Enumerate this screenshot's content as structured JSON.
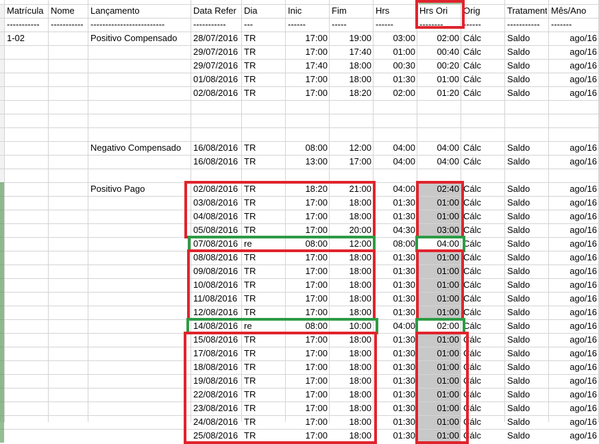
{
  "headers": [
    "Matrícula",
    "Nome",
    "Lançamento",
    "Data Refer",
    "Dia",
    "Inic",
    "Fim",
    "Hrs",
    "Hrs Ori",
    "Orig",
    "Tratament",
    "Mês/Ano"
  ],
  "dashes": [
    "-----------",
    "-----------",
    "-------------------------",
    "-----------",
    "---",
    "------",
    "-----",
    "------",
    "--------",
    "------",
    "-----------",
    "-------"
  ],
  "colors": {
    "red_box": "#e0242d",
    "green_box": "#2e9b45",
    "gray_fill": "#c8c8c8",
    "gridline": "#d4d4d4"
  },
  "groups": [
    {
      "matricula": "1-02",
      "lancamento": "Positivo Compensado",
      "rows": [
        [
          "28/07/2016",
          "TR",
          "17:00",
          "19:00",
          "03:00",
          "02:00",
          "Cálc",
          "Saldo",
          "ago/16"
        ],
        [
          "29/07/2016",
          "TR",
          "17:00",
          "17:40",
          "01:00",
          "00:40",
          "Cálc",
          "Saldo",
          "ago/16"
        ],
        [
          "29/07/2016",
          "TR",
          "17:40",
          "18:00",
          "00:30",
          "00:20",
          "Cálc",
          "Saldo",
          "ago/16"
        ],
        [
          "01/08/2016",
          "TR",
          "17:00",
          "18:00",
          "01:30",
          "01:00",
          "Cálc",
          "Saldo",
          "ago/16"
        ],
        [
          "02/08/2016",
          "TR",
          "17:00",
          "18:20",
          "02:00",
          "01:20",
          "Cálc",
          "Saldo",
          "ago/16"
        ]
      ]
    },
    {
      "matricula": "",
      "lancamento": "Negativo Compensado",
      "rows": [
        [
          "16/08/2016",
          "TR",
          "08:00",
          "12:00",
          "04:00",
          "04:00",
          "Cálc",
          "Saldo",
          "ago/16"
        ],
        [
          "16/08/2016",
          "TR",
          "13:00",
          "17:00",
          "04:00",
          "04:00",
          "Cálc",
          "Saldo",
          "ago/16"
        ]
      ]
    },
    {
      "matricula": "",
      "lancamento": "Positivo Pago",
      "rows": [
        [
          "02/08/2016",
          "TR",
          "18:20",
          "21:00",
          "04:00",
          "02:40",
          "Cálc",
          "Saldo",
          "ago/16"
        ],
        [
          "03/08/2016",
          "TR",
          "17:00",
          "18:00",
          "01:30",
          "01:00",
          "Cálc",
          "Saldo",
          "ago/16"
        ],
        [
          "04/08/2016",
          "TR",
          "17:00",
          "18:00",
          "01:30",
          "01:00",
          "Cálc",
          "Saldo",
          "ago/16"
        ],
        [
          "05/08/2016",
          "TR",
          "17:00",
          "20:00",
          "04:30",
          "03:00",
          "Cálc",
          "Saldo",
          "ago/16"
        ],
        [
          "07/08/2016",
          "re",
          "08:00",
          "12:00",
          "08:00",
          "04:00",
          "Cálc",
          "Saldo",
          "ago/16"
        ],
        [
          "08/08/2016",
          "TR",
          "17:00",
          "18:00",
          "01:30",
          "01:00",
          "Cálc",
          "Saldo",
          "ago/16"
        ],
        [
          "09/08/2016",
          "TR",
          "17:00",
          "18:00",
          "01:30",
          "01:00",
          "Cálc",
          "Saldo",
          "ago/16"
        ],
        [
          "10/08/2016",
          "TR",
          "17:00",
          "18:00",
          "01:30",
          "01:00",
          "Cálc",
          "Saldo",
          "ago/16"
        ],
        [
          "11/08/2016",
          "TR",
          "17:00",
          "18:00",
          "01:30",
          "01:00",
          "Cálc",
          "Saldo",
          "ago/16"
        ],
        [
          "12/08/2016",
          "TR",
          "17:00",
          "18:00",
          "01:30",
          "01:00",
          "Cálc",
          "Saldo",
          "ago/16"
        ],
        [
          "14/08/2016",
          "re",
          "08:00",
          "10:00",
          "04:00",
          "02:00",
          "Cálc",
          "Saldo",
          "ago/16"
        ],
        [
          "15/08/2016",
          "TR",
          "17:00",
          "18:00",
          "01:30",
          "01:00",
          "Cálc",
          "Saldo",
          "ago/16"
        ],
        [
          "17/08/2016",
          "TR",
          "17:00",
          "18:00",
          "01:30",
          "01:00",
          "Cálc",
          "Saldo",
          "ago/16"
        ],
        [
          "18/08/2016",
          "TR",
          "17:00",
          "18:00",
          "01:30",
          "01:00",
          "Cálc",
          "Saldo",
          "ago/16"
        ],
        [
          "19/08/2016",
          "TR",
          "17:00",
          "18:00",
          "01:30",
          "01:00",
          "Cálc",
          "Saldo",
          "ago/16"
        ],
        [
          "22/08/2016",
          "TR",
          "17:00",
          "18:00",
          "01:30",
          "01:00",
          "Cálc",
          "Saldo",
          "ago/16"
        ],
        [
          "23/08/2016",
          "TR",
          "17:00",
          "18:00",
          "01:30",
          "01:00",
          "Cálc",
          "Saldo",
          "ago/16"
        ],
        [
          "24/08/2016",
          "TR",
          "17:00",
          "18:00",
          "01:30",
          "01:00",
          "Cálc",
          "Saldo",
          "ago/16"
        ],
        [
          "25/08/2016",
          "TR",
          "17:00",
          "18:00",
          "01:30",
          "01:00",
          "Cálc",
          "Saldo",
          "ago/16"
        ]
      ]
    }
  ]
}
